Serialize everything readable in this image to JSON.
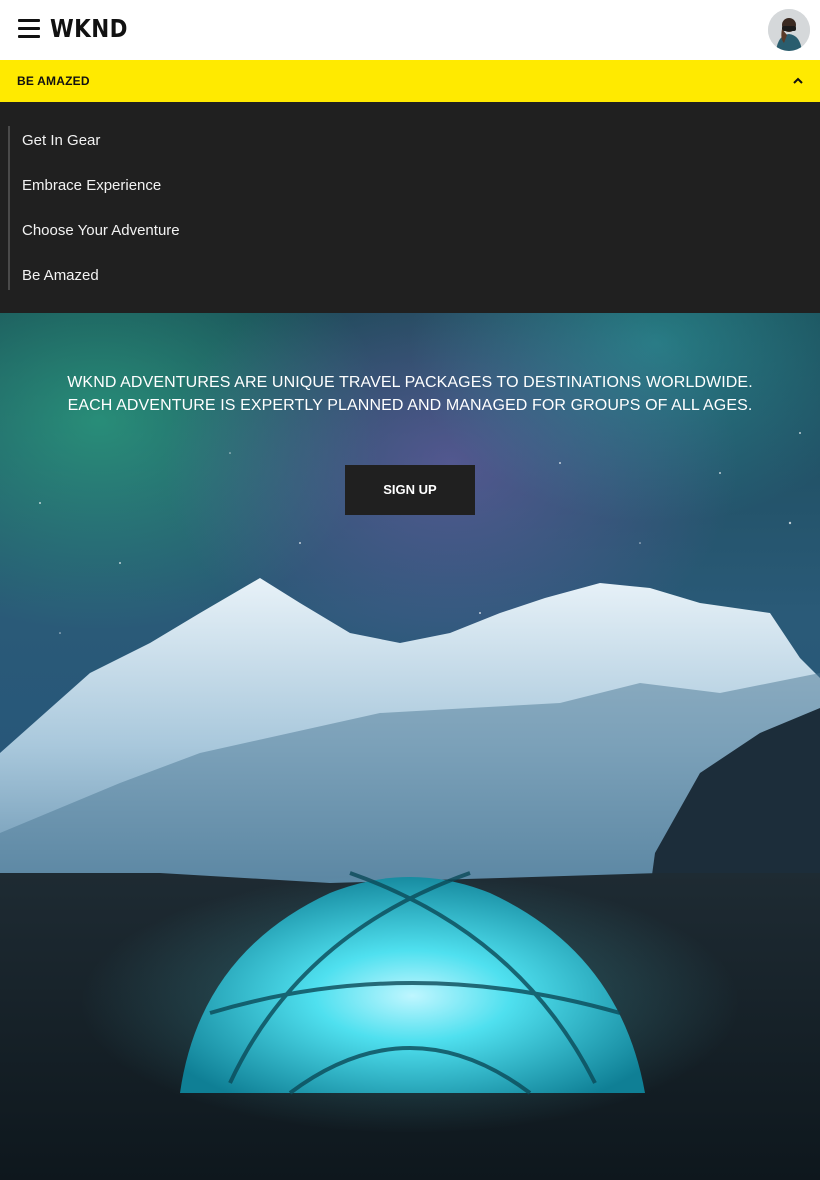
{
  "header": {
    "logo": "WKND",
    "menu_icon": "hamburger-menu-icon",
    "avatar_icon": "user-avatar"
  },
  "section_toggle": {
    "label": "BE AMAZED",
    "icon": "chevron-up-icon",
    "accent": "#ffea00"
  },
  "nav": {
    "items": [
      {
        "label": "Get In Gear"
      },
      {
        "label": "Embrace Experience"
      },
      {
        "label": "Choose Your Adventure"
      },
      {
        "label": "Be Amazed"
      }
    ]
  },
  "hero": {
    "line1": "WKND ADVENTURES ARE UNIQUE TRAVEL PACKAGES TO DESTINATIONS WORLDWIDE.",
    "line2": "EACH ADVENTURE IS EXPERTLY PLANNED AND MANAGED FOR GROUPS OF ALL AGES.",
    "cta_label": "SIGN UP"
  }
}
